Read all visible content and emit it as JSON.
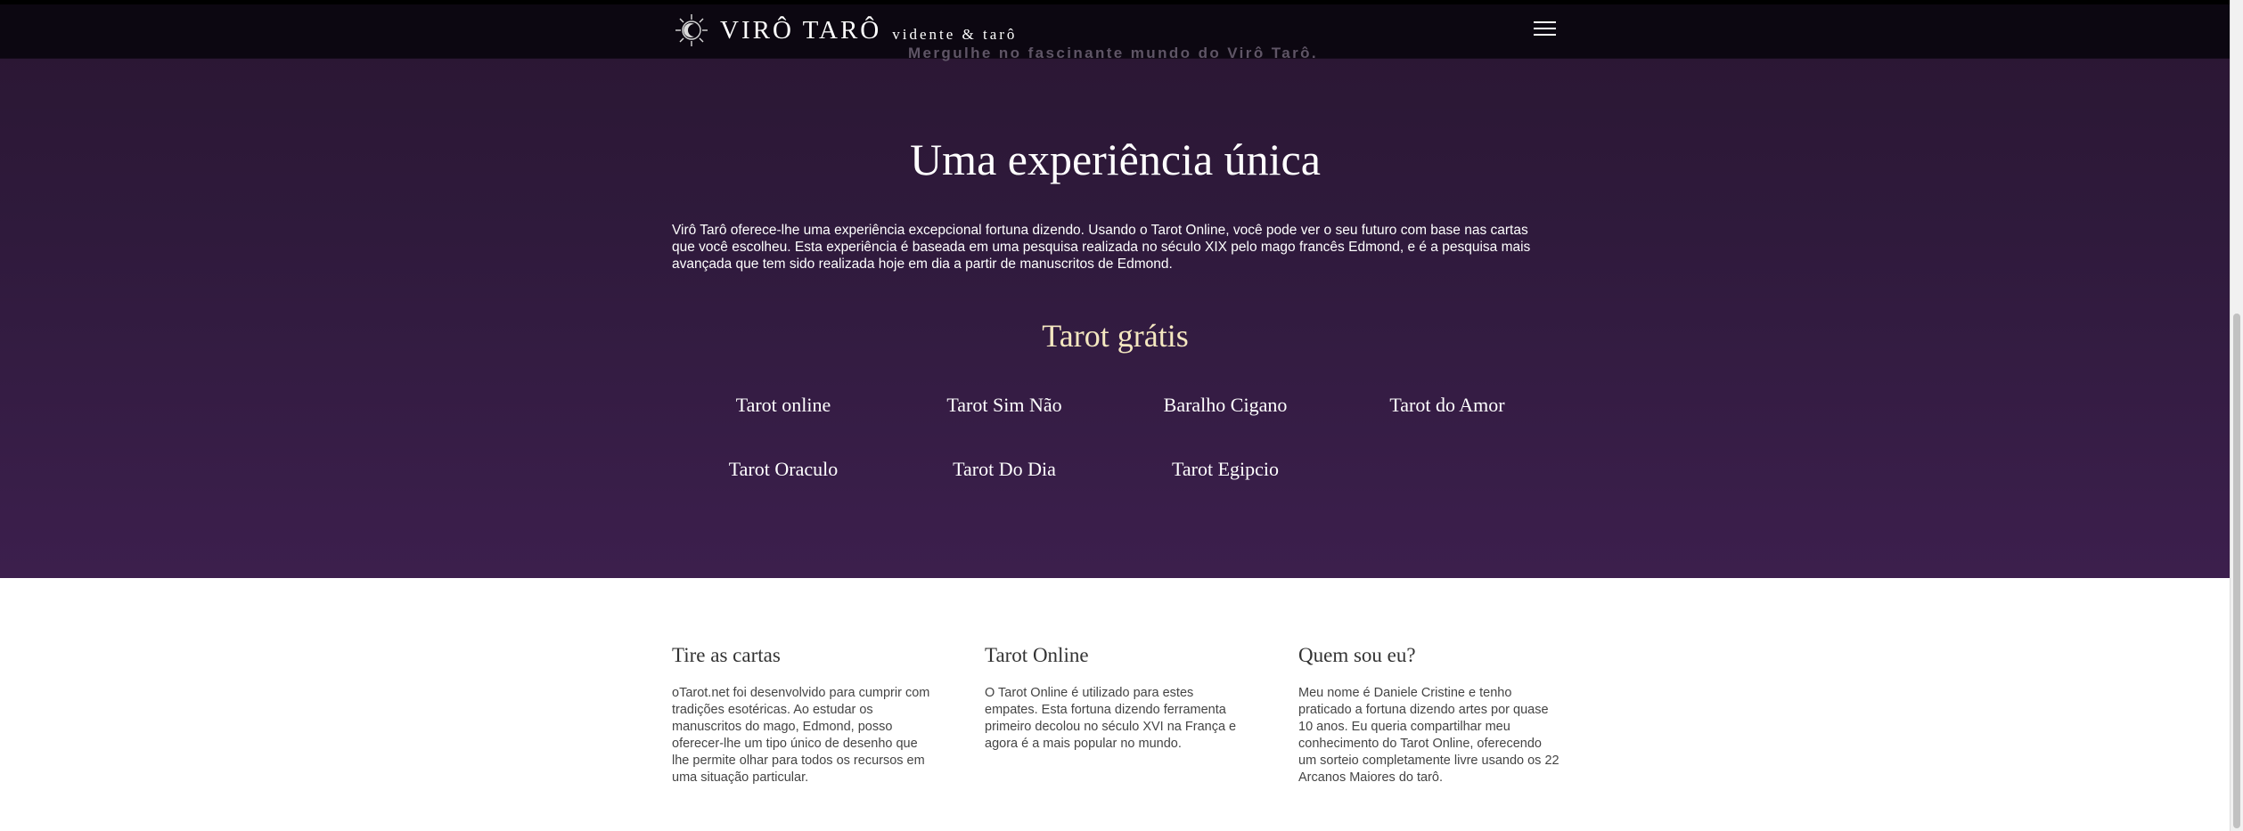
{
  "header": {
    "brand": "VIRÔ TARÔ",
    "tagline": "vidente & tarô",
    "slogan": "Mergulhe no fascinante mundo do Virô Tarô."
  },
  "hero": {
    "title": "Uma experiência única",
    "text": "Virô Tarô oferece-lhe uma experiência excepcional fortuna dizendo. Usando o Tarot Online, você pode ver o seu futuro com base nas cartas que você escolheu. Esta experiência é baseada em uma pesquisa realizada no século XIX pelo mago francês Edmond, e é a pesquisa mais avançada que tem sido realizada hoje em dia a partir de manuscritos de Edmond."
  },
  "free_tarot": {
    "title": "Tarot grátis",
    "links": [
      "Tarot online",
      "Tarot Sim Não",
      "Baralho Cigano",
      "Tarot do Amor",
      "Tarot Oraculo",
      "Tarot Do Dia",
      "Tarot Egipcio"
    ]
  },
  "footer": {
    "columns": [
      {
        "title": "Tire as cartas",
        "text": "oTarot.net foi desenvolvido para cumprir com tradições esotéricas. Ao estudar os manuscritos do mago, Edmond, posso oferecer-lhe um tipo único de desenho que lhe permite olhar para todos os recursos em uma situação particular."
      },
      {
        "title": "Tarot Online",
        "text": "O Tarot Online é utilizado para estes empates. Esta fortuna dizendo ferramenta primeiro decolou no século XVI na França e agora é a mais popular no mundo."
      },
      {
        "title": "Quem sou eu?",
        "text": "Meu nome é Daniele Cristine e tenho praticado a fortuna dizendo artes por quase 10 anos. Eu queria compartilhar meu conhecimento do Tarot Online, oferecendo um sorteio completamente livre usando os 22 Arcanos Maiores do tarô."
      }
    ]
  },
  "icons": {
    "logo": "sun-moon-logo-icon",
    "menu": "hamburger-menu-icon"
  },
  "colors": {
    "hero_top": "#2a1632",
    "hero_bottom": "#3c1f4d",
    "section_title": "#f4e7c0",
    "navbar": "#0a060e"
  }
}
